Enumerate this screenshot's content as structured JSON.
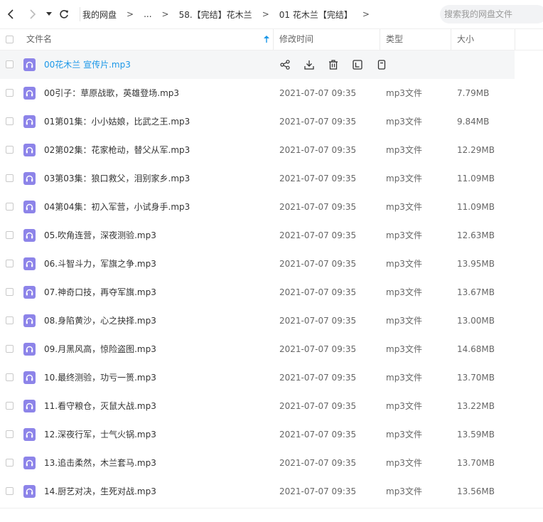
{
  "nav": {
    "back_icon": "chevron-left-icon",
    "forward_icon": "chevron-right-icon",
    "dropdown_icon": "caret-down-icon",
    "refresh_icon": "refresh-icon"
  },
  "breadcrumb": {
    "items": [
      "我的网盘",
      "...",
      "58.【完结】花木兰",
      "01 花木兰【完结】"
    ],
    "separator": ">"
  },
  "search": {
    "placeholder": "搜索我的网盘文件"
  },
  "columns": {
    "name": "文件名",
    "modified": "修改时间",
    "type": "类型",
    "size": "大小"
  },
  "row_actions": [
    "share-icon",
    "download-icon",
    "delete-icon",
    "rename-icon",
    "more-icon"
  ],
  "accent_color": "#1a97e8",
  "file_icon_color": "#8d84e9",
  "files": [
    {
      "name": "00花木兰 宣传片.mp3",
      "modified": "",
      "type": "",
      "size": "",
      "hovered": true
    },
    {
      "name": "00引子：草原战歌，英雄登场.mp3",
      "modified": "2021-07-07 09:35",
      "type": "mp3文件",
      "size": "7.79MB"
    },
    {
      "name": "01第01集：小小姑娘，比武之王.mp3",
      "modified": "2021-07-07 09:35",
      "type": "mp3文件",
      "size": "9.84MB"
    },
    {
      "name": "02第02集：花家枪动，替父从军.mp3",
      "modified": "2021-07-07 09:35",
      "type": "mp3文件",
      "size": "12.29MB"
    },
    {
      "name": "03第03集：狼口救父，泪别家乡.mp3",
      "modified": "2021-07-07 09:35",
      "type": "mp3文件",
      "size": "11.09MB"
    },
    {
      "name": "04第04集：初入军营，小试身手.mp3",
      "modified": "2021-07-07 09:35",
      "type": "mp3文件",
      "size": "11.09MB"
    },
    {
      "name": "05.吹角连营，深夜测验.mp3",
      "modified": "2021-07-07 09:35",
      "type": "mp3文件",
      "size": "12.63MB"
    },
    {
      "name": "06.斗智斗力，军旗之争.mp3",
      "modified": "2021-07-07 09:35",
      "type": "mp3文件",
      "size": "13.95MB"
    },
    {
      "name": "07.神奇口技，再夺军旗.mp3",
      "modified": "2021-07-07 09:35",
      "type": "mp3文件",
      "size": "13.67MB"
    },
    {
      "name": "08.身陷黄沙，心之抉择.mp3",
      "modified": "2021-07-07 09:35",
      "type": "mp3文件",
      "size": "13.00MB"
    },
    {
      "name": "09.月黑风高，惊险盗图.mp3",
      "modified": "2021-07-07 09:35",
      "type": "mp3文件",
      "size": "14.68MB"
    },
    {
      "name": "10.最终测验，功亏一篑.mp3",
      "modified": "2021-07-07 09:35",
      "type": "mp3文件",
      "size": "13.70MB"
    },
    {
      "name": "11.看守粮仓，灭鼠大战.mp3",
      "modified": "2021-07-07 09:35",
      "type": "mp3文件",
      "size": "13.22MB"
    },
    {
      "name": "12.深夜行军，士气火锅.mp3",
      "modified": "2021-07-07 09:35",
      "type": "mp3文件",
      "size": "13.59MB"
    },
    {
      "name": "13.追击柔然，木兰套马.mp3",
      "modified": "2021-07-07 09:35",
      "type": "mp3文件",
      "size": "13.70MB"
    },
    {
      "name": "14.厨艺对决，生死对战.mp3",
      "modified": "2021-07-07 09:35",
      "type": "mp3文件",
      "size": "13.56MB"
    }
  ]
}
